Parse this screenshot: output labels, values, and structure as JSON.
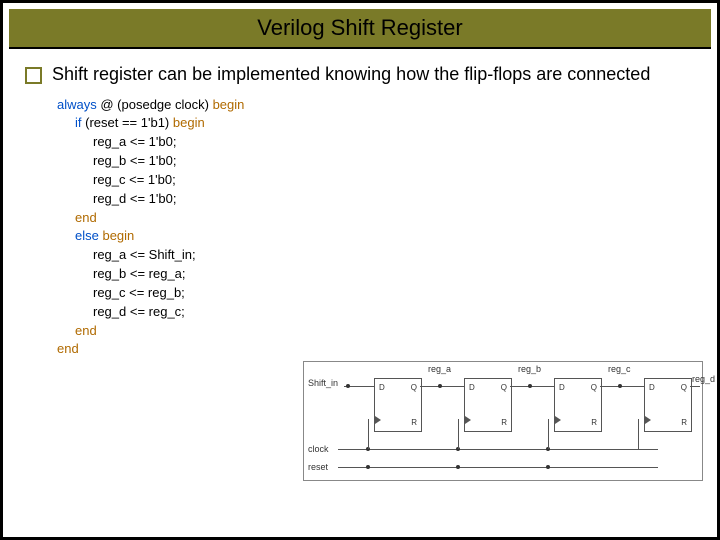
{
  "title": "Verilog Shift Register",
  "bullet": "Shift register can be implemented knowing how the flip-flops are connected",
  "code": {
    "l1a": "always",
    "l1b": " @ (posedge clock) ",
    "l1c": "begin",
    "l2a": "if",
    "l2b": " (reset == 1'b1)   ",
    "l2c": "begin",
    "l3": "reg_a <= 1'b0;",
    "l4": "reg_b <= 1'b0;",
    "l5": "reg_c <= 1'b0;",
    "l6": "reg_d <= 1'b0;",
    "l7": "end",
    "l8a": "else ",
    "l8b": "begin",
    "l9": "reg_a <= Shift_in;",
    "l10": "reg_b <= reg_a;",
    "l11": "reg_c <= reg_b;",
    "l12": "reg_d <= reg_c;",
    "l13": "end",
    "l14": "end"
  },
  "diagram": {
    "shift_in": "Shift_in",
    "clock": "clock",
    "reset": "reset",
    "D": "D",
    "Q": "Q",
    "R": "R",
    "reg_a": "reg_a",
    "reg_b": "reg_b",
    "reg_c": "reg_c",
    "reg_d": "reg_d"
  }
}
